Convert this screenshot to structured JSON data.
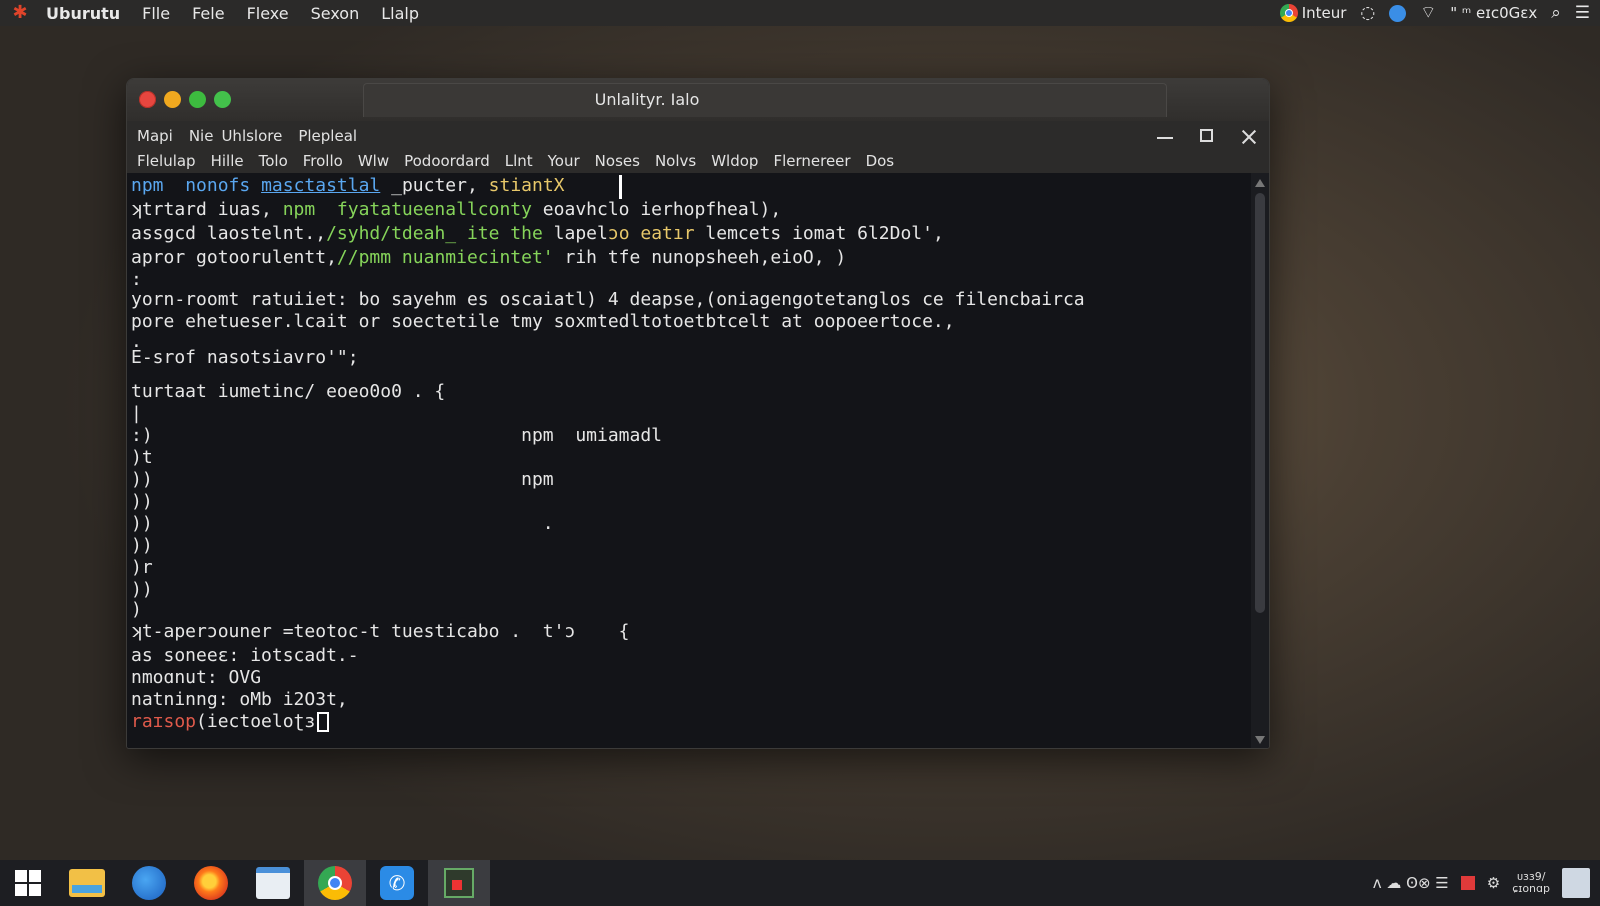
{
  "top_bar": {
    "app_name": "Uburutu",
    "menu": [
      "Flle",
      "Fele",
      "Flexe",
      "Sexon",
      "Llalp"
    ],
    "tray": {
      "browser_label": "Inteur",
      "status_text": "\" ᵐ eɪc0Gɛx"
    }
  },
  "window": {
    "title": "Unlalityr. Ialo",
    "menu_row1": [
      "Mapi",
      "Nie",
      "Uhlslore",
      "Plepleal"
    ],
    "menu_row2": [
      "Flelulap",
      "Hille",
      "Tolo",
      "Frollo",
      "Wlw",
      "Podoordard",
      "Llnt",
      "Your",
      "Noses",
      "Nolvs",
      "Wldop",
      "Flernereer",
      "Dos"
    ]
  },
  "terminal": {
    "lines": [
      {
        "id": "l0",
        "segments": [
          {
            "text": "npm ",
            "color": "blue"
          },
          {
            "text": " nonofs ",
            "color": "blue"
          },
          {
            "text": "masctastlal",
            "color": "blue",
            "underline": true
          },
          {
            "text": " _pucter, ",
            "color": "white"
          },
          {
            "text": "stiantX",
            "color": "yellow"
          }
        ]
      },
      {
        "id": "l1",
        "segments": [
          {
            "text": "ʞtrtard iuas, ",
            "color": "white"
          },
          {
            "text": "npm  fyatatueenallconty",
            "color": "green"
          },
          {
            "text": " eoavhclo ierhopfheal),",
            "color": "white"
          }
        ]
      },
      {
        "id": "l2",
        "segments": [
          {
            "text": "assgcd laostelnt.,",
            "color": "white"
          },
          {
            "text": "/syhd/tdeah_ ite the",
            "color": "green"
          },
          {
            "text": " lapel",
            "color": "white"
          },
          {
            "text": "ɔo eatır",
            "color": "yellow"
          },
          {
            "text": " lemcets iomat 6l2Dol',",
            "color": "white"
          }
        ]
      },
      {
        "id": "l3",
        "segments": [
          {
            "text": "apror gotoorulentt,",
            "color": "white"
          },
          {
            "text": "//pmm nuanmiecintet'",
            "color": "green"
          },
          {
            "text": " rih tfe nunopsheeh,eioO, )",
            "color": "white"
          }
        ]
      },
      {
        "id": "l4",
        "segments": [
          {
            "text": ":",
            "color": "white"
          }
        ]
      },
      {
        "id": "l5",
        "segments": [
          {
            "text": "yorn-roomt ratuiiet: bo sayehm es oscaiatl) 4 deapse,(oniagengotetanglos ce filencbairca",
            "color": "white"
          }
        ]
      },
      {
        "id": "l6",
        "segments": [
          {
            "text": "pore ehetueser.lcait or soectetile tmy soxmtedltotoetbtcelt at oopoeertoce.,",
            "color": "white"
          }
        ]
      },
      {
        "id": "l7",
        "segments": [
          {
            "text": ".",
            "color": "white"
          }
        ]
      },
      {
        "id": "l8",
        "segments": [
          {
            "text": "E-srof nasotsiavro'\";",
            "color": "white"
          }
        ]
      },
      {
        "id": "l9",
        "segments": [
          {
            "text": "turtaat iumetinc/ eoeo0o0 . {",
            "color": "white"
          }
        ]
      },
      {
        "id": "l10",
        "segments": [
          {
            "text": "|",
            "color": "white"
          }
        ]
      },
      {
        "id": "l11",
        "segments": [
          {
            "text": ":)                                  npm  umiamadl",
            "color": "white"
          }
        ]
      },
      {
        "id": "l12",
        "segments": [
          {
            "text": ")t",
            "color": "white"
          }
        ]
      },
      {
        "id": "l13",
        "segments": [
          {
            "text": "))                                  npm",
            "color": "white"
          }
        ]
      },
      {
        "id": "l14",
        "segments": [
          {
            "text": "))",
            "color": "white"
          }
        ]
      },
      {
        "id": "l15",
        "segments": [
          {
            "text": "))                                    .",
            "color": "white"
          }
        ]
      },
      {
        "id": "l16",
        "segments": [
          {
            "text": "))",
            "color": "white"
          }
        ]
      },
      {
        "id": "l17",
        "segments": [
          {
            "text": ")r",
            "color": "white"
          }
        ]
      },
      {
        "id": "l18",
        "segments": [
          {
            "text": "))",
            "color": "white"
          }
        ]
      },
      {
        "id": "l19",
        "segments": [
          {
            "text": ")",
            "color": "white"
          }
        ]
      },
      {
        "id": "l20",
        "segments": [
          {
            "text": "ʞt-aperɔouner =teotoc-t tuesticabo .  t'ɔ    {",
            "color": "white"
          }
        ]
      },
      {
        "id": "l21",
        "segments": [
          {
            "text": "as soneeɛ: iotscadt.-",
            "color": "white"
          }
        ]
      },
      {
        "id": "l22",
        "segments": [
          {
            "text": "nmoɑnut: OVG",
            "color": "white"
          }
        ]
      },
      {
        "id": "l23",
        "segments": [
          {
            "text": "natninng: oMb i2O3t,",
            "color": "white"
          }
        ]
      },
      {
        "id": "l24",
        "segments": [
          {
            "text": "raɪsop",
            "color": "red"
          },
          {
            "text": "(iectoeloʈɜ",
            "color": "white"
          }
        ]
      }
    ]
  },
  "taskbar": {
    "clock_line1": "ᴜɜɜ9/",
    "clock_line2": "ɕɪᴏnɑp",
    "tray_text": "ᴧ ☁ Ꙩ⊗ ☰"
  },
  "colors": {
    "blue": "#5aa7f0",
    "green": "#86d45a",
    "yellow": "#e8c86a",
    "red": "#e05a4b",
    "white": "#e6e6e6"
  }
}
